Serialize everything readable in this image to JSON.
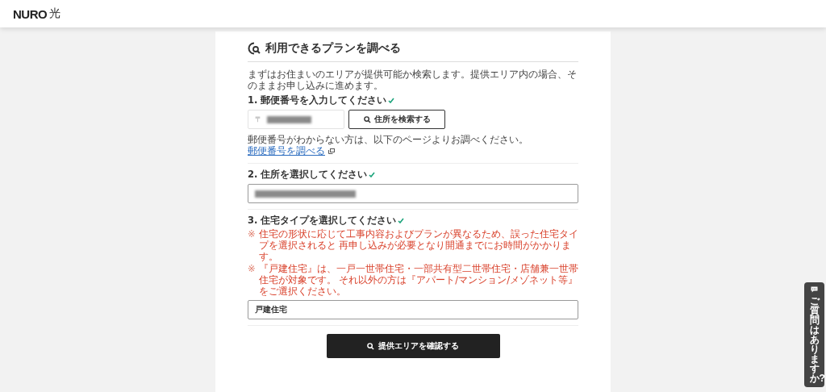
{
  "header": {
    "logo": "NURO",
    "logo_mark": "光"
  },
  "form": {
    "title": "利用できるプランを調べる",
    "intro": "まずはお住まいのエリアが提供可能か検索します。提供エリア内の場合、そのままお申し込みに進めます。",
    "steps": [
      {
        "kind": "postal",
        "label": "1. 郵便番号を入力してください",
        "done": true,
        "prefix": "〒",
        "button": "住所を検索する",
        "help": "郵便番号がわからない方は、以下のページよりお調べください。",
        "link": "郵便番号を調べる"
      },
      {
        "kind": "address",
        "label": "2. 住所を選択してください",
        "done": true
      },
      {
        "kind": "type",
        "label": "3. 住宅タイプを選択してください",
        "done": true,
        "notes": [
          "住宅の形状に応じて工事内容およびプランが異なるため、誤った住宅タイプを選択されると 再申し込みが必要となり開通までにお時間がかかります。",
          "『戸建住宅』は、一戸一世帯住宅・一部共有型二世帯住宅・店舗兼一世帯住宅が対象です。 それ以外の方は『アパート/マンション/メゾネット等』をご選択ください。"
        ],
        "note_mark": "※",
        "value": "戸建住宅"
      }
    ],
    "submit": "提供エリアを確認する"
  },
  "help_tab": {
    "label": "ご質問はありますか?"
  }
}
